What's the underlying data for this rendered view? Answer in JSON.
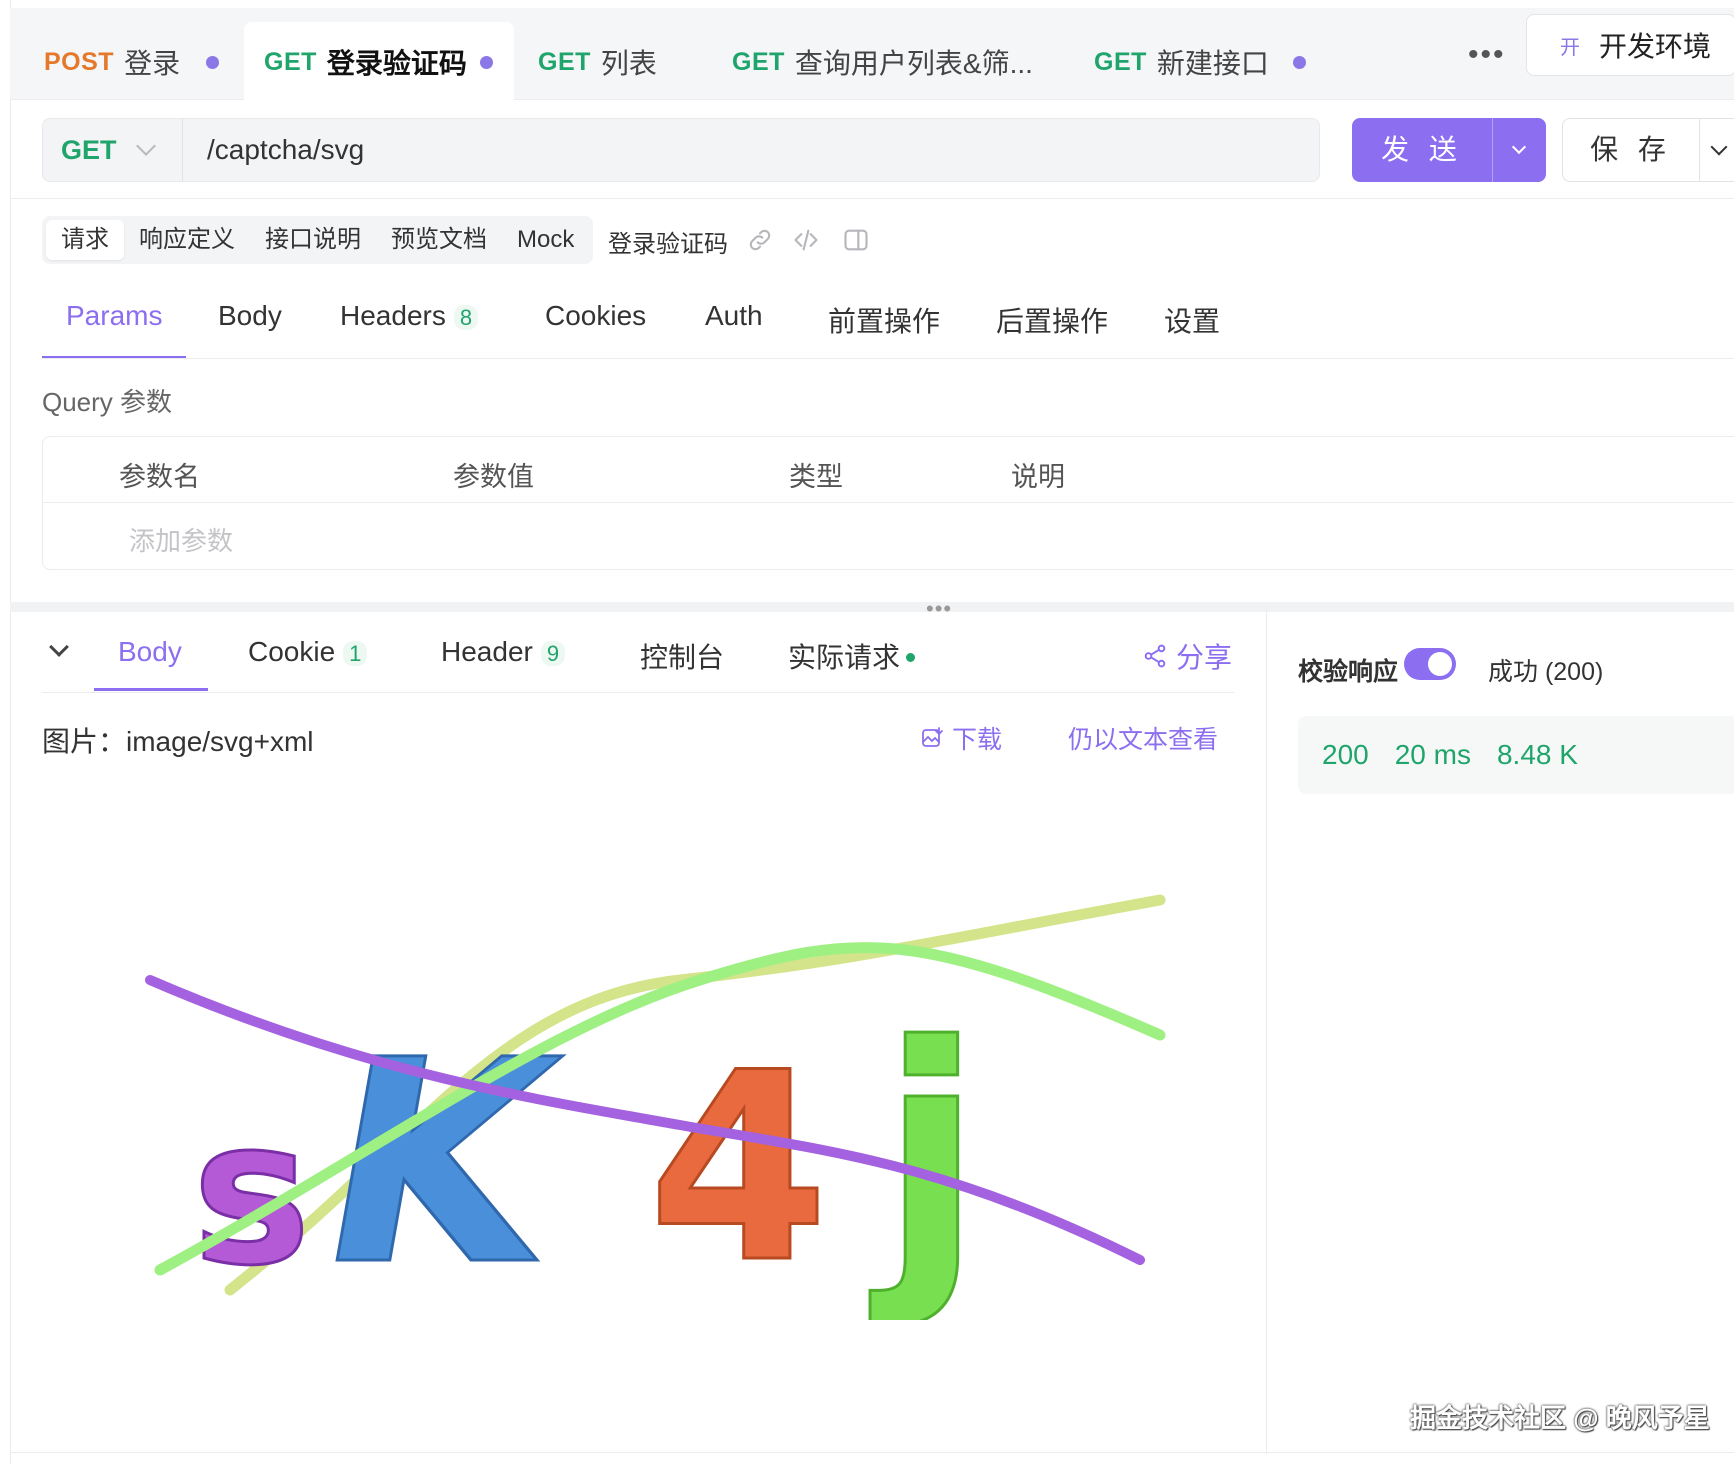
{
  "tabs": [
    {
      "method": "POST",
      "name": "登录",
      "dirty": true,
      "active": false
    },
    {
      "method": "GET",
      "name": "登录验证码",
      "dirty": true,
      "active": true
    },
    {
      "method": "GET",
      "name": "列表",
      "dirty": false,
      "active": false
    },
    {
      "method": "GET",
      "name": "查询用户列表&筛...",
      "dirty": false,
      "active": false
    },
    {
      "method": "GET",
      "name": "新建接口",
      "dirty": true,
      "active": false
    }
  ],
  "more_label": "•••",
  "environment": {
    "icon_char": "开",
    "name": "开发环境"
  },
  "request": {
    "method": "GET",
    "url": "/captcha/svg",
    "send_label": "发 送",
    "save_label": "保 存"
  },
  "doc_tabs": [
    "请求",
    "响应定义",
    "接口说明",
    "预览文档",
    "Mock"
  ],
  "doc_title": "登录验证码",
  "request_tabs": [
    {
      "label": "Params",
      "count": ""
    },
    {
      "label": "Body",
      "count": ""
    },
    {
      "label": "Headers",
      "count": "8"
    },
    {
      "label": "Cookies",
      "count": ""
    },
    {
      "label": "Auth",
      "count": ""
    },
    {
      "label": "前置操作",
      "count": ""
    },
    {
      "label": "后置操作",
      "count": ""
    },
    {
      "label": "设置",
      "count": ""
    }
  ],
  "query_label": "Query 参数",
  "params_table": {
    "columns": [
      "参数名",
      "参数值",
      "类型",
      "说明"
    ],
    "add_placeholder": "添加参数"
  },
  "drag_handle": "•••",
  "response_tabs": [
    {
      "label": "Body",
      "count": ""
    },
    {
      "label": "Cookie",
      "count": "1"
    },
    {
      "label": "Header",
      "count": "9"
    },
    {
      "label": "控制台",
      "count": ""
    },
    {
      "label": "实际请求",
      "count": ""
    }
  ],
  "share_label": "分享",
  "image_label": "图片：image/svg+xml",
  "download_label": "下载",
  "view_as_text_label": "仍以文本查看",
  "validate_label": "校验响应",
  "validate_on": true,
  "status_text": "成功 (200)",
  "metrics": {
    "code": "200",
    "time": "20 ms",
    "size": "8.48 K"
  },
  "captcha_text": "sK4j",
  "colors": {
    "accent": "#8c6ef0",
    "get": "#1fa56b",
    "post": "#e5782a"
  },
  "watermark": "掘金技术社区 @ 晚风予星"
}
